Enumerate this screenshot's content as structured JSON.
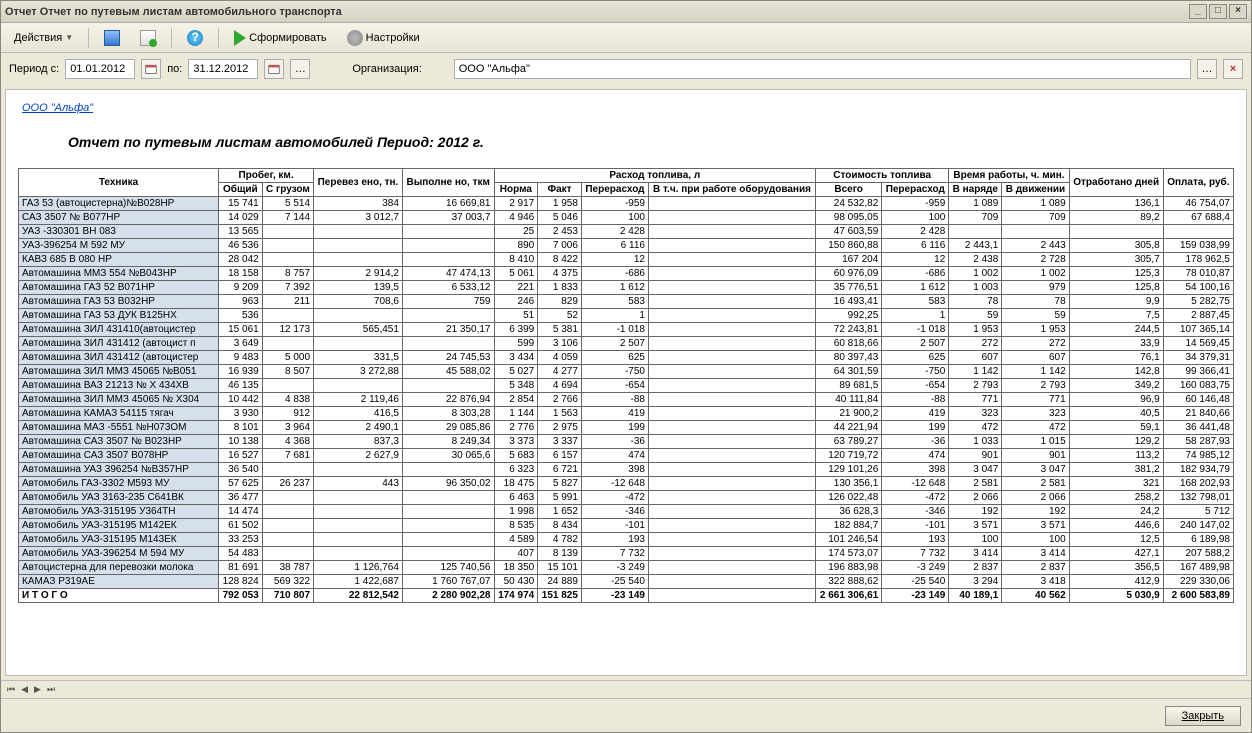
{
  "window": {
    "title": "Отчет  Отчет по путевым листам автомобильного транспорта"
  },
  "toolbar": {
    "actions": "Действия",
    "form": "Сформировать",
    "settings": "Настройки"
  },
  "filter": {
    "period_from_label": "Период с:",
    "period_from": "01.01.2012",
    "period_to_label": "по:",
    "period_to": "31.12.2012",
    "org_label": "Организация:",
    "org_value": "ООО \"Альфа\""
  },
  "report": {
    "org_link": "ООО \"Альфа\"",
    "title": "Отчет по путевым листам автомобилей  Период: 2012 г."
  },
  "headers": {
    "tech": "Техника",
    "mileage_group": "Пробег, км.",
    "mileage_total": "Общий",
    "mileage_cargo": "С грузом",
    "transported": "Перевез ено, тн.",
    "done": "Выполне но, ткм",
    "fuel_group": "Расход топлива, л",
    "fuel_norm": "Норма",
    "fuel_fact": "Факт",
    "fuel_over": "Перерасход",
    "fuel_equip": "В т.ч. при работе оборудования",
    "cost_group": "Стоимость топлива",
    "cost_total": "Всего",
    "cost_over": "Перерасход",
    "time_group": "Время работы, ч. мин.",
    "time_on": "В наряде",
    "time_move": "В движении",
    "days": "Отработано дней",
    "pay": "Оплата, руб."
  },
  "chart_data": {
    "type": "table",
    "columns": [
      "Техника",
      "Общий",
      "С грузом",
      "Перевезено, тн.",
      "Выполнено, ткм",
      "Норма",
      "Факт",
      "Перерасход",
      "В т.ч. при работе оборудования",
      "Всего",
      "Перерасход",
      "В наряде",
      "В движении",
      "Отработано дней",
      "Оплата, руб."
    ],
    "rows": [
      [
        "ГАЗ 53 (автоцистерна)№В028НР",
        "15 741",
        "5 514",
        "384",
        "16 669,81",
        "2 917",
        "1 958",
        "-959",
        "",
        "24 532,82",
        "-959",
        "1 089",
        "1 089",
        "136,1",
        "46 754,07"
      ],
      [
        "САЗ 3507  № В077НР",
        "14 029",
        "7 144",
        "3 012,7",
        "37 003,7",
        "4 946",
        "5 046",
        "100",
        "",
        "98 095,05",
        "100",
        "709",
        "709",
        "89,2",
        "67 688,4"
      ],
      [
        "УАЗ -330301 ВН 083",
        "13 565",
        "",
        "",
        "",
        "25",
        "2 453",
        "2 428",
        "",
        "47 603,59",
        "2 428",
        "",
        "",
        "",
        ""
      ],
      [
        "УАЗ-396254  М 592 МУ",
        "46 536",
        "",
        "",
        "",
        "890",
        "7 006",
        "6 116",
        "",
        "150 860,88",
        "6 116",
        "2 443,1",
        "2 443",
        "305,8",
        "159 038,99"
      ],
      [
        "КАВЗ 685  В 080 НР",
        "28 042",
        "",
        "",
        "",
        "8 410",
        "8 422",
        "12",
        "",
        "167 204",
        "12",
        "2 438",
        "2 728",
        "305,7",
        "178 962,5"
      ],
      [
        "Автомашина   ММЗ 554   №В043НР",
        "18 158",
        "8 757",
        "2 914,2",
        "47 474,13",
        "5 061",
        "4 375",
        "-686",
        "",
        "60 976,09",
        "-686",
        "1 002",
        "1 002",
        "125,3",
        "78 010,87"
      ],
      [
        "Автомашина  ГАЗ 52   В071НР",
        "9 209",
        "7 392",
        "139,5",
        "6 533,12",
        "221",
        "1 833",
        "1 612",
        "",
        "35 776,51",
        "1 612",
        "1 003",
        "979",
        "125,8",
        "54 100,16"
      ],
      [
        "Автомашина  ГАЗ 53  В032НР",
        "963",
        "211",
        "708,6",
        "759",
        "246",
        "829",
        "583",
        "",
        "16 493,41",
        "583",
        "78",
        "78",
        "9,9",
        "5 282,75"
      ],
      [
        "Автомашина  ГАЗ 53  ДУК  В125НХ",
        "536",
        "",
        "",
        "",
        "51",
        "52",
        "1",
        "",
        "992,25",
        "1",
        "59",
        "59",
        "7,5",
        "2 887,45"
      ],
      [
        "Автомашина  ЗИЛ 431410(автоцистер",
        "15 061",
        "12 173",
        "565,451",
        "21 350,17",
        "6 399",
        "5 381",
        "-1 018",
        "",
        "72 243,81",
        "-1 018",
        "1 953",
        "1 953",
        "244,5",
        "107 365,14"
      ],
      [
        "Автомашина  ЗИЛ 431412 (автоцист п",
        "3 649",
        "",
        "",
        "",
        "599",
        "3 106",
        "2 507",
        "",
        "60 818,66",
        "2 507",
        "272",
        "272",
        "33,9",
        "14 569,45"
      ],
      [
        "Автомашина  ЗИЛ 431412 (автоцистер",
        "9 483",
        "5 000",
        "331,5",
        "24 745,53",
        "3 434",
        "4 059",
        "625",
        "",
        "80 397,43",
        "625",
        "607",
        "607",
        "76,1",
        "34 379,31"
      ],
      [
        "Автомашина  ЗИЛ ММЗ 45065 №В051",
        "16 939",
        "8 507",
        "3 272,88",
        "45 588,02",
        "5 027",
        "4 277",
        "-750",
        "",
        "64 301,59",
        "-750",
        "1 142",
        "1 142",
        "142,8",
        "99 366,41"
      ],
      [
        "Автомашина ВАЗ 21213 № Х 434ХВ",
        "46 135",
        "",
        "",
        "",
        "5 348",
        "4 694",
        "-654",
        "",
        "89 681,5",
        "-654",
        "2 793",
        "2 793",
        "349,2",
        "160 083,75"
      ],
      [
        "Автомашина ЗИЛ ММЗ 45065  № Х304",
        "10 442",
        "4 838",
        "2 119,46",
        "22 876,94",
        "2 854",
        "2 766",
        "-88",
        "",
        "40 111,84",
        "-88",
        "771",
        "771",
        "96,9",
        "60 146,48"
      ],
      [
        "Автомашина КАМАЗ 54115 тягач",
        "3 930",
        "912",
        "416,5",
        "8 303,28",
        "1 144",
        "1 563",
        "419",
        "",
        "21 900,2",
        "419",
        "323",
        "323",
        "40,5",
        "21 840,66"
      ],
      [
        "Автомашина МАЗ -5551  №Н073ОМ",
        "8 101",
        "3 964",
        "2 490,1",
        "29 085,86",
        "2 776",
        "2 975",
        "199",
        "",
        "44 221,94",
        "199",
        "472",
        "472",
        "59,1",
        "36 441,48"
      ],
      [
        "Автомашина САЗ 3507 № В023НР",
        "10 138",
        "4 368",
        "837,3",
        "8 249,34",
        "3 373",
        "3 337",
        "-36",
        "",
        "63 789,27",
        "-36",
        "1 033",
        "1 015",
        "129,2",
        "58 287,93"
      ],
      [
        "Автомашина САЗ 3507 В078НР",
        "16 527",
        "7 681",
        "2 627,9",
        "30 065,6",
        "5 683",
        "6 157",
        "474",
        "",
        "120 719,72",
        "474",
        "901",
        "901",
        "113,2",
        "74 985,12"
      ],
      [
        "Автомашина УАЗ 396254 №В357НР",
        "36 540",
        "",
        "",
        "",
        "6 323",
        "6 721",
        "398",
        "",
        "129 101,26",
        "398",
        "3 047",
        "3 047",
        "381,2",
        "182 934,79"
      ],
      [
        "Автомобиль ГАЗ-3302 М593 МУ",
        "57 625",
        "26 237",
        "443",
        "96 350,02",
        "18 475",
        "5 827",
        "-12 648",
        "",
        "130 356,1",
        "-12 648",
        "2 581",
        "2 581",
        "321",
        "168 202,93"
      ],
      [
        "Автомобиль УАЗ 3163-235 С641ВК",
        "36 477",
        "",
        "",
        "",
        "6 463",
        "5 991",
        "-472",
        "",
        "126 022,48",
        "-472",
        "2 066",
        "2 066",
        "258,2",
        "132 798,01"
      ],
      [
        "Автомобиль УАЗ-315195  У364ТН",
        "14 474",
        "",
        "",
        "",
        "1 998",
        "1 652",
        "-346",
        "",
        "36 628,3",
        "-346",
        "192",
        "192",
        "24,2",
        "5 712"
      ],
      [
        "Автомобиль УАЗ-315195 М142ЕК",
        "61 502",
        "",
        "",
        "",
        "8 535",
        "8 434",
        "-101",
        "",
        "182 884,7",
        "-101",
        "3 571",
        "3 571",
        "446,6",
        "240 147,02"
      ],
      [
        "Автомобиль УАЗ-315195 М143ЕК",
        "33 253",
        "",
        "",
        "",
        "4 589",
        "4 782",
        "193",
        "",
        "101 246,54",
        "193",
        "100",
        "100",
        "12,5",
        "6 189,98"
      ],
      [
        "Автомобиль УАЗ-396254  М 594 МУ",
        "54 483",
        "",
        "",
        "",
        "407",
        "8 139",
        "7 732",
        "",
        "174 573,07",
        "7 732",
        "3 414",
        "3 414",
        "427,1",
        "207 588,2"
      ],
      [
        "Автоцистерна для перевозки  молока",
        "81 691",
        "38 787",
        "1 126,764",
        "125 740,56",
        "18 350",
        "15 101",
        "-3 249",
        "",
        "196 883,98",
        "-3 249",
        "2 837",
        "2 837",
        "356,5",
        "167 489,98"
      ],
      [
        "КАМАЗ   Р319АЕ",
        "128 824",
        "569 322",
        "1 422,687",
        "1 760 767,07",
        "50 430",
        "24 889",
        "-25 540",
        "",
        "322 888,62",
        "-25 540",
        "3 294",
        "3 418",
        "412,9",
        "229 330,06"
      ]
    ],
    "total_row": [
      "И Т О Г О",
      "792 053",
      "710 807",
      "22 812,542",
      "2 280 902,28",
      "174 974",
      "151 825",
      "-23 149",
      "",
      "2 661 306,61",
      "-23 149",
      "40 189,1",
      "40 562",
      "5 030,9",
      "2 600 583,89"
    ]
  },
  "footer": {
    "close": "Закрыть"
  }
}
